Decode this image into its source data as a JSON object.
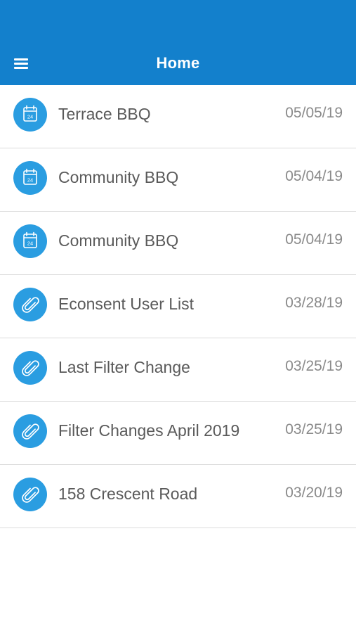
{
  "header": {
    "title": "Home",
    "menu_icon": "hamburger-menu-icon",
    "background_color": "#1380cc"
  },
  "items": [
    {
      "title": "Terrace BBQ",
      "date": "05/05/19",
      "icon": "calendar-icon",
      "calendar_day": "24"
    },
    {
      "title": "Community BBQ",
      "date": "05/04/19",
      "icon": "calendar-icon",
      "calendar_day": "24"
    },
    {
      "title": "Community BBQ",
      "date": "05/04/19",
      "icon": "calendar-icon",
      "calendar_day": "24"
    },
    {
      "title": "Econsent User List",
      "date": "03/28/19",
      "icon": "paperclip-icon"
    },
    {
      "title": "Last Filter Change",
      "date": "03/25/19",
      "icon": "paperclip-icon"
    },
    {
      "title": "Filter Changes April 2019",
      "date": "03/25/19",
      "icon": "paperclip-icon"
    },
    {
      "title": "158 Crescent Road",
      "date": "03/20/19",
      "icon": "paperclip-icon"
    }
  ],
  "colors": {
    "icon_circle": "#2a9de1",
    "title_text": "#5a5a5a",
    "date_text": "#8a8a8a",
    "divider": "#dcdcdc"
  }
}
